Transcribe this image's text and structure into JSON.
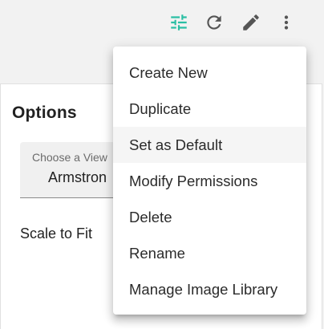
{
  "toolbar": {
    "buttons": [
      {
        "icon": "tune-icon",
        "color": "#2bbfa4"
      },
      {
        "icon": "refresh-icon",
        "color": "#555555"
      },
      {
        "icon": "pencil-icon",
        "color": "#555555"
      },
      {
        "icon": "more-vertical-icon",
        "color": "#555555"
      }
    ]
  },
  "panel": {
    "title": "Options",
    "view_select": {
      "label": "Choose a View",
      "value": "Armstron"
    },
    "scale_to_fit_label": "Scale to Fit"
  },
  "menu": {
    "items": [
      {
        "label": "Create New"
      },
      {
        "label": "Duplicate"
      },
      {
        "label": "Set as Default",
        "hovered": true
      },
      {
        "label": "Modify Permissions"
      },
      {
        "label": "Delete"
      },
      {
        "label": "Rename"
      },
      {
        "label": "Manage Image Library"
      }
    ]
  },
  "colors": {
    "accent": "#2bbfa4",
    "icon": "#555555",
    "hover_bg": "#f5f5f5"
  }
}
